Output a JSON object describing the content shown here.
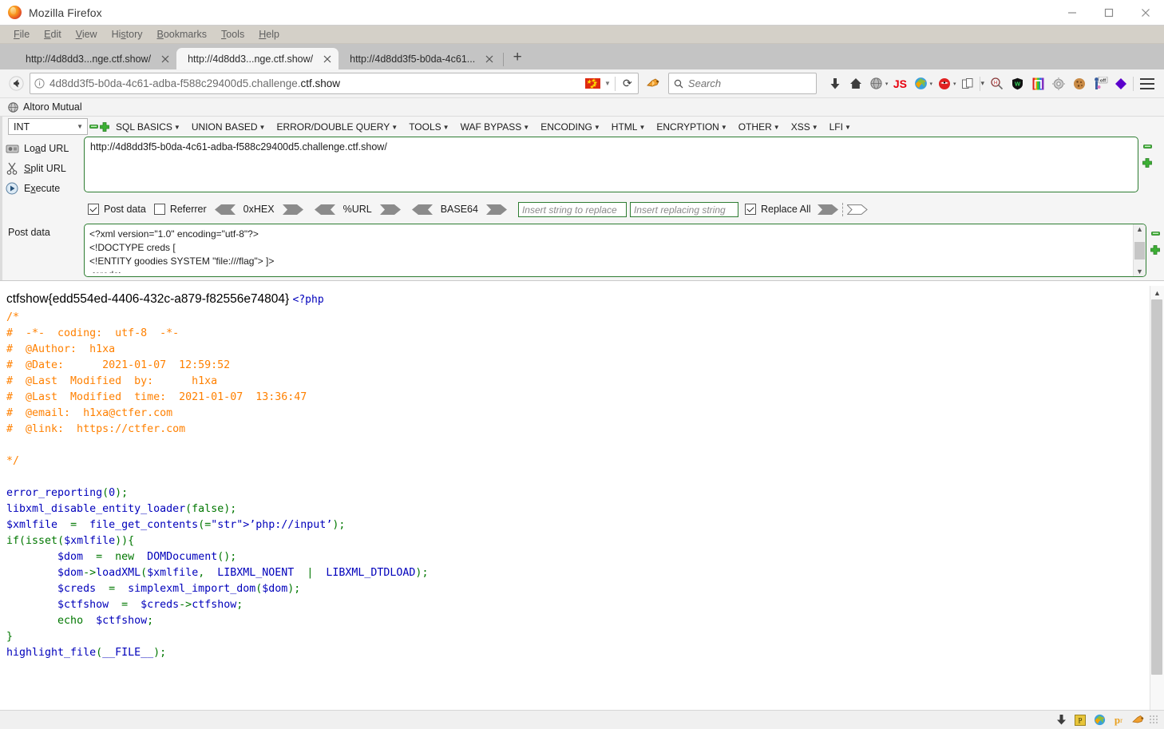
{
  "window": {
    "title": "Mozilla Firefox",
    "controls": {
      "minimize": "minimize-icon",
      "maximize": "maximize-icon",
      "close": "close-icon"
    }
  },
  "menubar": {
    "items": [
      {
        "label": "File",
        "accel": "F"
      },
      {
        "label": "Edit",
        "accel": "E"
      },
      {
        "label": "View",
        "accel": "V"
      },
      {
        "label": "History",
        "accel": "s"
      },
      {
        "label": "Bookmarks",
        "accel": "B"
      },
      {
        "label": "Tools",
        "accel": "T"
      },
      {
        "label": "Help",
        "accel": "H"
      }
    ]
  },
  "tabs": [
    {
      "label": "http://4d8dd3...nge.ctf.show/",
      "active": false
    },
    {
      "label": "http://4d8dd3...nge.ctf.show/",
      "active": true
    },
    {
      "label": "http://4d8dd3f5-b0da-4c61...",
      "active": false
    }
  ],
  "newtab_label": "+",
  "navbar": {
    "back_icon": "back-arrow-icon",
    "url_prefix": "4d8dd3f5-b0da-4c61-adba-f588c29400d5.challenge.",
    "url_domain": "ctf.show",
    "info_icon": "site-info-icon",
    "reload_icon": "reload-icon",
    "flag_icon": "china-flag-icon",
    "search_placeholder": "Search",
    "extensions": [
      "download-arrow-icon",
      "home-icon",
      "globe-grey-icon",
      "js-toggle-icon",
      "proxy-swirl-icon",
      "hackbar-icon",
      "page-copy-icon",
      "zoom-search-icon",
      "wappalyzer-shield-icon",
      "rainbow-icon",
      "gear-icon",
      "cookie-icon",
      "off-toggle-icon",
      "diamond-icon",
      "hamburger-menu-icon"
    ]
  },
  "bookmarks": {
    "items": [
      {
        "label": "Altoro Mutual",
        "icon": "globe-icon"
      }
    ]
  },
  "hackbar": {
    "type_select": {
      "value": "INT"
    },
    "minus_label": "−",
    "plus_label": "+",
    "menus": [
      "SQL BASICS",
      "UNION BASED",
      "ERROR/DOUBLE QUERY",
      "TOOLS",
      "WAF BYPASS",
      "ENCODING",
      "HTML",
      "ENCRYPTION",
      "OTHER",
      "XSS",
      "LFI"
    ],
    "actions": [
      {
        "label": "Load URL",
        "icon": "load-url-icon"
      },
      {
        "label": "Split URL",
        "icon": "scissors-icon"
      },
      {
        "label": "Execute",
        "icon": "execute-play-icon"
      }
    ],
    "url_value": "http://4d8dd3f5-b0da-4c61-adba-f588c29400d5.challenge.ctf.show/",
    "options": {
      "post_data": {
        "label": "Post data",
        "checked": true
      },
      "referrer": {
        "label": "Referrer",
        "checked": false
      },
      "encoders": [
        "0xHEX",
        "%URL",
        "BASE64"
      ],
      "replace_from_placeholder": "Insert string to replace",
      "replace_to_placeholder": "Insert replacing string",
      "replace_all": {
        "label": "Replace All",
        "checked": true
      }
    },
    "post_label": "Post data",
    "post_value": "<?xml version=\"1.0\" encoding=\"utf-8\"?>\n<!DOCTYPE creds [\n<!ENTITY goodies SYSTEM \"file:///flag\"> ]>\n<creds>"
  },
  "page": {
    "flag": "ctfshow{edd554ed-4406-432c-a879-f82556e74804}",
    "php_open": "<?php",
    "code_lines": [
      {
        "t": "comment",
        "text": "/*"
      },
      {
        "t": "comment",
        "text": "#  -*-  coding:  utf-8  -*-"
      },
      {
        "t": "comment",
        "text": "#  @Author:  h1xa"
      },
      {
        "t": "comment",
        "text": "#  @Date:      2021-01-07  12:59:52"
      },
      {
        "t": "comment",
        "text": "#  @Last  Modified  by:      h1xa"
      },
      {
        "t": "comment",
        "text": "#  @Last  Modified  time:  2021-01-07  13:36:47"
      },
      {
        "t": "comment",
        "text": "#  @email:  h1xa@ctfer.com"
      },
      {
        "t": "comment",
        "text": "#  @link:  https://ctfer.com"
      },
      {
        "t": "blank",
        "text": ""
      },
      {
        "t": "comment",
        "text": "*/"
      },
      {
        "t": "blank",
        "text": ""
      },
      {
        "t": "code",
        "text": "error_reporting(0);"
      },
      {
        "t": "code",
        "text": "libxml_disable_entity_loader(false);"
      },
      {
        "t": "code",
        "text": "$xmlfile  =  file_get_contents('php://input');"
      },
      {
        "t": "code",
        "text": "if(isset($xmlfile)){"
      },
      {
        "t": "code",
        "text": "        $dom  =  new  DOMDocument();"
      },
      {
        "t": "code",
        "text": "        $dom->loadXML($xmlfile,  LIBXML_NOENT  |  LIBXML_DTDLOAD);"
      },
      {
        "t": "code",
        "text": "        $creds  =  simplexml_import_dom($dom);"
      },
      {
        "t": "code",
        "text": "        $ctfshow  =  $creds->ctfshow;"
      },
      {
        "t": "code",
        "text": "        echo  $ctfshow;"
      },
      {
        "t": "code",
        "text": "}"
      },
      {
        "t": "code",
        "text": "highlight_file(__FILE__);"
      }
    ]
  },
  "statusbar": {
    "icons": [
      "download-arrow-icon",
      "p-badge-icon",
      "proxy-swirl-icon",
      "pr-icon",
      "hackbar-icon",
      "resize-grip-icon"
    ]
  },
  "colors": {
    "accent_green": "#2e7d32",
    "comment": "#FF8000",
    "keyword": "#007700",
    "string": "#DD0000",
    "default_code": "#0000BB",
    "tab_active_bg": "#f5f5f5",
    "chrome_bg": "#f3f3f3"
  }
}
